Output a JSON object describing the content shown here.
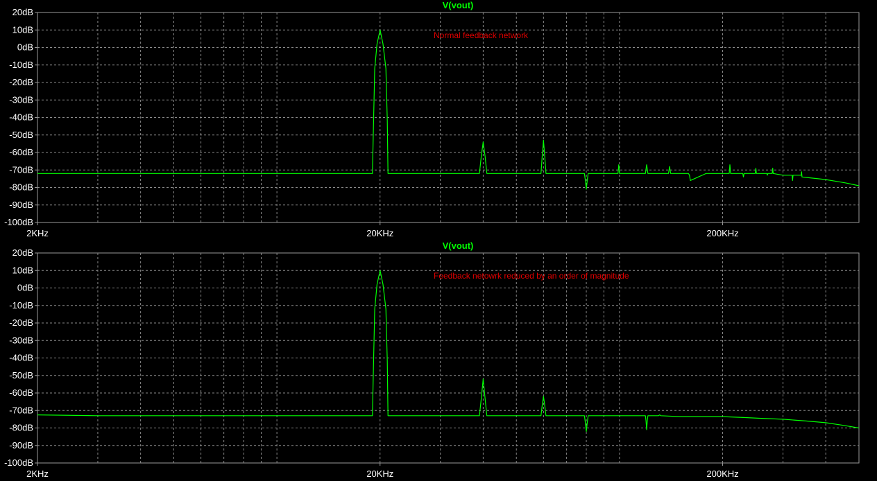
{
  "colors": {
    "background": "#000000",
    "axis": "#9a9a9a",
    "grid": "#8a8a8a",
    "tick_text": "#ffffff",
    "trace": "#00ff00",
    "title": "#00ff00",
    "annotation": "#e00000"
  },
  "chart_data": [
    {
      "type": "line",
      "title": "V(vout)",
      "annotation": "Normal feedback network",
      "x_scale": "log",
      "xlim": [
        2000,
        500000
      ],
      "ylim": [
        -100,
        20
      ],
      "x_ticks": [
        2000,
        20000,
        200000
      ],
      "x_tick_labels": [
        "2KHz",
        "20KHz",
        "200KHz"
      ],
      "y_ticks": [
        20,
        10,
        0,
        -10,
        -20,
        -30,
        -40,
        -50,
        -60,
        -70,
        -80,
        -90,
        -100
      ],
      "y_tick_labels": [
        "20dB",
        "10dB",
        "0dB",
        "-10dB",
        "-20dB",
        "-30dB",
        "-40dB",
        "-50dB",
        "-60dB",
        "-70dB",
        "-80dB",
        "-90dB",
        "-100dB"
      ],
      "grid": true,
      "series": [
        {
          "x": [
            2000,
            19000,
            19150,
            19300,
            19600,
            20000,
            20400,
            20800,
            21000,
            21100,
            39000,
            39500,
            40000,
            40500,
            41000,
            59000,
            59500,
            60000,
            60500,
            61000,
            79000,
            79500,
            80000,
            80500,
            81000,
            99000,
            99500,
            100000,
            100500,
            101000,
            119000,
            120000,
            121000,
            139000,
            140000,
            141000,
            159000,
            160000,
            161000,
            179000,
            180000,
            181000,
            209000,
            210000,
            211000,
            229000,
            230000,
            231000,
            249000,
            250000,
            251000,
            269000,
            270000,
            271000,
            279000,
            280000,
            281000,
            300000,
            319000,
            320000,
            321000,
            339000,
            340000,
            341000,
            360000,
            380000,
            400000,
            430000,
            460000,
            500000
          ],
          "y": [
            -72,
            -72,
            -42,
            -12,
            2,
            10,
            2,
            -12,
            -42,
            -72,
            -72,
            -62,
            -54,
            -62,
            -72,
            -72,
            -62,
            -53,
            -62,
            -72,
            -72,
            -76,
            -81,
            -76,
            -72,
            -72,
            -67,
            -72,
            -72,
            -72,
            -72,
            -67,
            -72,
            -72,
            -68,
            -72,
            -72,
            -73,
            -76,
            -72,
            -72,
            -72,
            -72,
            -67,
            -72,
            -72,
            -74,
            -72,
            -72,
            -69,
            -72,
            -72,
            -73,
            -72,
            -72,
            -69,
            -72,
            -73,
            -73,
            -76,
            -73,
            -73,
            -71,
            -74,
            -74.5,
            -75,
            -75.5,
            -76.5,
            -77.5,
            -79
          ]
        }
      ]
    },
    {
      "type": "line",
      "title": "V(vout)",
      "annotation": "Feedback netowrk reduced by an order of magnitude",
      "x_scale": "log",
      "xlim": [
        2000,
        500000
      ],
      "ylim": [
        -100,
        20
      ],
      "x_ticks": [
        2000,
        20000,
        200000
      ],
      "x_tick_labels": [
        "2KHz",
        "20KHz",
        "200KHz"
      ],
      "y_ticks": [
        20,
        10,
        0,
        -10,
        -20,
        -30,
        -40,
        -50,
        -60,
        -70,
        -80,
        -90,
        -100
      ],
      "y_tick_labels": [
        "20dB",
        "10dB",
        "0dB",
        "-10dB",
        "-20dB",
        "-30dB",
        "-40dB",
        "-50dB",
        "-60dB",
        "-70dB",
        "-80dB",
        "-90dB",
        "-100dB"
      ],
      "grid": true,
      "series": [
        {
          "x": [
            2000,
            3000,
            19000,
            19150,
            19300,
            19600,
            20000,
            20400,
            20800,
            21000,
            21100,
            39000,
            39500,
            40000,
            40500,
            41000,
            59000,
            59500,
            60000,
            60500,
            61000,
            79000,
            79500,
            80000,
            80500,
            81000,
            119000,
            119500,
            120000,
            120500,
            121000,
            130000,
            131000,
            132000,
            150000,
            200000,
            230000,
            260000,
            300000,
            350000,
            400000,
            450000,
            500000
          ],
          "y": [
            -72.5,
            -73,
            -73,
            -42,
            -12,
            2,
            10,
            2,
            -12,
            -42,
            -73,
            -73,
            -63,
            -52,
            -63,
            -73,
            -73,
            -67,
            -62,
            -67,
            -73,
            -73,
            -77,
            -82,
            -77,
            -73,
            -73,
            -76,
            -81,
            -76,
            -73,
            -73,
            -72.5,
            -73,
            -73.5,
            -73.5,
            -74,
            -74.5,
            -75,
            -76,
            -77,
            -78.5,
            -80
          ]
        }
      ]
    }
  ]
}
